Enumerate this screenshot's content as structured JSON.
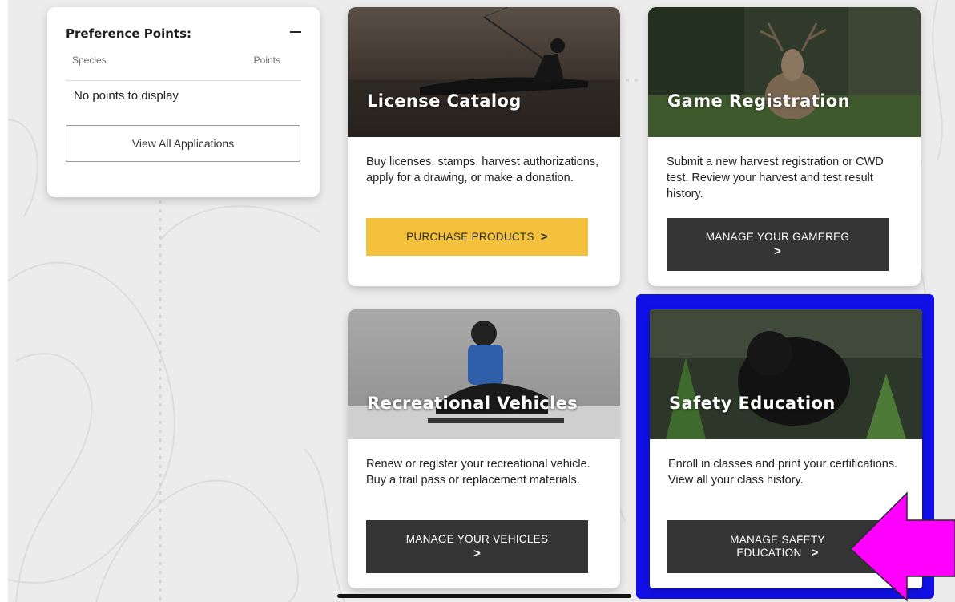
{
  "preference": {
    "title": "Preference Points:",
    "col_species": "Species",
    "col_points": "Points",
    "empty_text": "No points to display",
    "button_label": "View All Applications"
  },
  "cards": [
    {
      "title": "License Catalog",
      "description": "Buy licenses, stamps, harvest authorizations, apply for a drawing, or make a donation.",
      "button_label": "PURCHASE PRODUCTS",
      "chevron": ">"
    },
    {
      "title": "Game Registration",
      "description": "Submit a new harvest registration or CWD test. Review your harvest and test result history.",
      "button_label": "MANAGE YOUR GAMEREG",
      "chevron": ">"
    },
    {
      "title": "Recreational Vehicles",
      "description": "Renew or register your recreational vehicle. Buy a trail pass or replacement materials.",
      "button_label": "MANAGE YOUR VEHICLES",
      "chevron": ">"
    },
    {
      "title": "Safety Education",
      "description": "Enroll in classes and print your certifications. View all your class history.",
      "button_label_line1": "MANAGE SAFETY",
      "button_label_line2": "EDUCATION",
      "chevron": ">"
    }
  ],
  "colors": {
    "highlight": "#1010e6",
    "arrow": "#ff00ff",
    "yellow_button": "#f3c13c",
    "dark_button": "#353535"
  }
}
